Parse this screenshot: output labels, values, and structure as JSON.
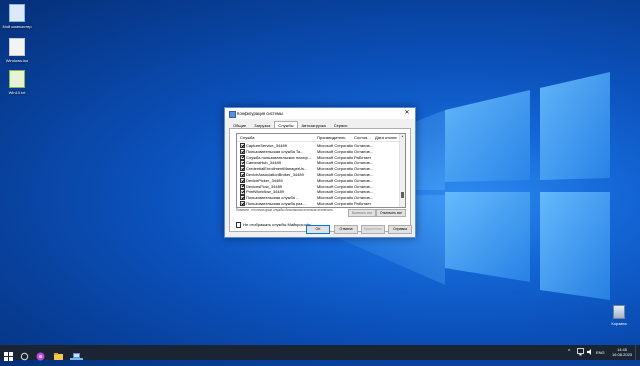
{
  "desktop": {
    "icons": [
      {
        "label": "Мой компьютер",
        "icon": "computer-icon"
      },
      {
        "label": "Windows.iso",
        "icon": "file-icon"
      },
      {
        "label": "Win10.txt",
        "icon": "text-file-icon"
      }
    ],
    "recycle_bin": {
      "label": "Корзина",
      "icon": "recycle-bin-icon"
    }
  },
  "dialog": {
    "title": "Конфигурация системы",
    "close_glyph": "✕",
    "tabs": [
      "Общие",
      "Загрузка",
      "Службы",
      "Автозагрузка",
      "Сервис"
    ],
    "active_tab": "Службы",
    "columns": [
      "Служба",
      "Производитель",
      "Состоя...",
      "Дата отключения"
    ],
    "rows": [
      {
        "name": "CaptureService_34489",
        "vendor": "Microsoft Corporation",
        "status": "Останов..."
      },
      {
        "name": "Пользовательская служба Ta...",
        "vendor": "Microsoft Corporation",
        "status": "Останов..."
      },
      {
        "name": "Служба пользовательских платф...",
        "vendor": "Microsoft Corporation",
        "status": "Работает"
      },
      {
        "name": "CameraHub_34489",
        "vendor": "Microsoft Corporation",
        "status": "Останов..."
      },
      {
        "name": "CredentialEnrollmentManagerUs...",
        "vendor": "Microsoft Corporation",
        "status": "Останов..."
      },
      {
        "name": "DeviceAssociationBroker_34489",
        "vendor": "Microsoft Corporation",
        "status": "Останов..."
      },
      {
        "name": "DevicePicker_34489",
        "vendor": "Microsoft Corporation",
        "status": "Останов..."
      },
      {
        "name": "DevicesFlow_34489",
        "vendor": "Microsoft Corporation",
        "status": "Останов..."
      },
      {
        "name": "PrintWorkflow_34489",
        "vendor": "Microsoft Corporation",
        "status": "Останов..."
      },
      {
        "name": "Пользовательская служба ...",
        "vendor": "Microsoft Corporation",
        "status": "Останов..."
      },
      {
        "name": "Пользовательская служба раз...",
        "vendor": "Microsoft Corporation",
        "status": "Работает"
      },
      {
        "name": "Пользовательская служба для...",
        "vendor": "Microsoft Corporation",
        "status": "Останов..."
      }
    ],
    "note": "Помните, что некоторые службы безопасности нельзя отключить.",
    "enable_all": "Включить все",
    "disable_all": "Отключить все",
    "hide_ms_label": "Не отображать службы Майкрософт",
    "buttons": {
      "ok": "ОК",
      "cancel": "Отмена",
      "apply": "Применить",
      "help": "Справка"
    }
  },
  "taskbar": {
    "lang": "ENG",
    "time": "14:45",
    "date": "16.08.2023"
  },
  "colors": {
    "accent": "#0078d7",
    "taskbar": "#1b2433"
  }
}
